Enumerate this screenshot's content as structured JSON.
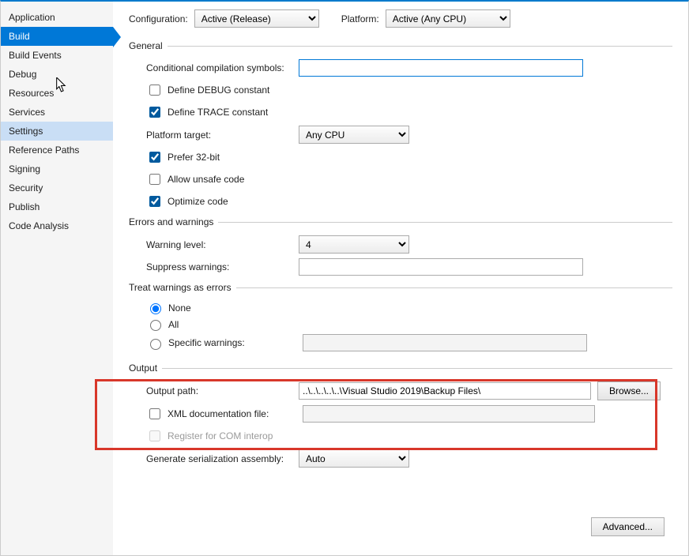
{
  "sidebar": {
    "items": [
      {
        "label": "Application"
      },
      {
        "label": "Build"
      },
      {
        "label": "Build Events"
      },
      {
        "label": "Debug"
      },
      {
        "label": "Resources"
      },
      {
        "label": "Services"
      },
      {
        "label": "Settings"
      },
      {
        "label": "Reference Paths"
      },
      {
        "label": "Signing"
      },
      {
        "label": "Security"
      },
      {
        "label": "Publish"
      },
      {
        "label": "Code Analysis"
      }
    ]
  },
  "top": {
    "config_label": "Configuration:",
    "config_value": "Active (Release)",
    "platform_label": "Platform:",
    "platform_value": "Active (Any CPU)"
  },
  "sections": {
    "general": "General",
    "errors": "Errors and warnings",
    "treat": "Treat warnings as errors",
    "output": "Output"
  },
  "general": {
    "cond_symbols_label": "Conditional compilation symbols:",
    "cond_symbols_value": "",
    "define_debug": "Define DEBUG constant",
    "define_trace": "Define TRACE constant",
    "platform_target_label": "Platform target:",
    "platform_target_value": "Any CPU",
    "prefer32": "Prefer 32-bit",
    "allow_unsafe": "Allow unsafe code",
    "optimize": "Optimize code"
  },
  "errors": {
    "warning_level_label": "Warning level:",
    "warning_level_value": "4",
    "suppress_label": "Suppress warnings:",
    "suppress_value": ""
  },
  "treat": {
    "none": "None",
    "all": "All",
    "specific": "Specific warnings:",
    "specific_value": ""
  },
  "output": {
    "path_label": "Output path:",
    "path_value": "..\\..\\..\\..\\..\\Visual Studio 2019\\Backup Files\\",
    "browse": "Browse...",
    "xml_doc": "XML documentation file:",
    "xml_doc_value": "",
    "register_com": "Register for COM interop",
    "gen_ser_label": "Generate serialization assembly:",
    "gen_ser_value": "Auto"
  },
  "advanced": "Advanced..."
}
